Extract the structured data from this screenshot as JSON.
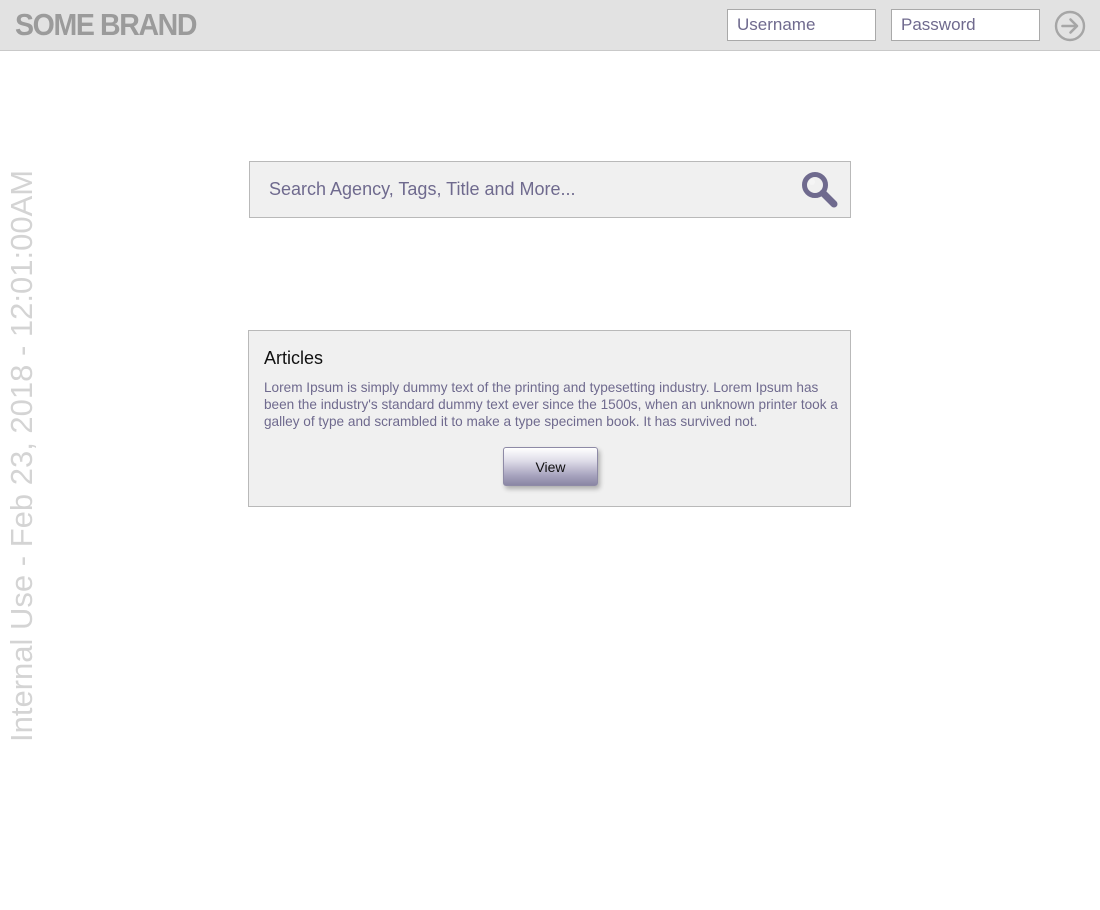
{
  "header": {
    "brand": "SOME BRAND",
    "username_placeholder": "Username",
    "password_placeholder": "Password",
    "submit_icon": "arrow-right-circle-icon"
  },
  "search": {
    "placeholder": "Search Agency, Tags, Title and More...",
    "icon": "search-icon"
  },
  "articles": {
    "title": "Articles",
    "body": "Lorem Ipsum is simply dummy text of the printing and typesetting industry. Lorem Ipsum has been the industry's standard dummy text ever since the 1500s, when an unknown printer took a galley of type and scrambled it to make a type specimen book. It has survived not.",
    "view_label": "View"
  },
  "watermark": {
    "text": "Internal Use - Feb 23, 2018 - 12:01:00AM"
  },
  "colors": {
    "header_bg": "#e2e2e2",
    "brand": "#9b9b9b",
    "accent_text": "#6f6a8e",
    "card_bg": "#f0f0f0",
    "watermark": "#d4d4d4"
  }
}
